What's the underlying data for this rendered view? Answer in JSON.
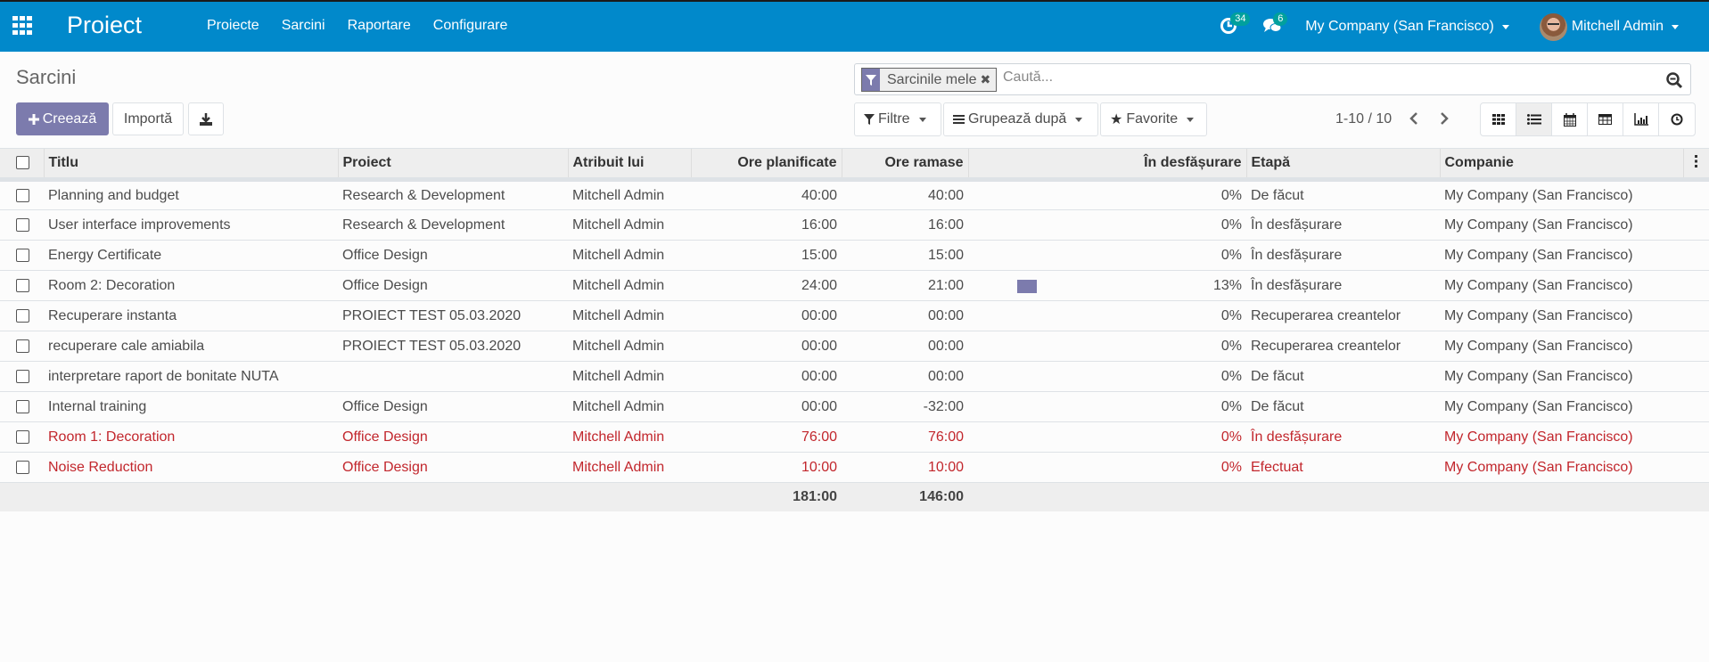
{
  "navbar": {
    "app_name": "Proiect",
    "menu": [
      "Proiecte",
      "Sarcini",
      "Raportare",
      "Configurare"
    ],
    "activity_badge": "34",
    "messages_badge": "6",
    "company": "My Company (San Francisco)",
    "user": "Mitchell Admin"
  },
  "control_panel": {
    "title": "Sarcini",
    "create_label": "Creează",
    "import_label": "Importă",
    "search": {
      "facet_label": "Sarcinile mele",
      "placeholder": "Caută..."
    },
    "filters_label": "Filtre",
    "groupby_label": "Grupează după",
    "favorites_label": "Favorite",
    "pager": "1-10 / 10",
    "views": [
      "kanban",
      "list",
      "calendar",
      "pivot",
      "graph",
      "activity"
    ],
    "active_view": "list"
  },
  "colors": {
    "navbar": "#0189cb",
    "primary": "#7c7bad",
    "late_text": "#c2262c"
  },
  "table": {
    "columns": [
      "Titlu",
      "Proiect",
      "Atribuit lui",
      "Ore planificate",
      "Ore ramase",
      "În desfășurare",
      "Etapă",
      "Companie"
    ],
    "rows": [
      {
        "title": "Planning and budget",
        "project": "Research & Development",
        "assignee": "Mitchell Admin",
        "planned": "40:00",
        "remaining": "40:00",
        "progress": 0,
        "progress_label": "0%",
        "stage": "De făcut",
        "company": "My Company (San Francisco)",
        "late": false
      },
      {
        "title": "User interface improvements",
        "project": "Research & Development",
        "assignee": "Mitchell Admin",
        "planned": "16:00",
        "remaining": "16:00",
        "progress": 0,
        "progress_label": "0%",
        "stage": "În desfășurare",
        "company": "My Company (San Francisco)",
        "late": false
      },
      {
        "title": "Energy Certificate",
        "project": "Office Design",
        "assignee": "Mitchell Admin",
        "planned": "15:00",
        "remaining": "15:00",
        "progress": 0,
        "progress_label": "0%",
        "stage": "În desfășurare",
        "company": "My Company (San Francisco)",
        "late": false
      },
      {
        "title": "Room 2: Decoration",
        "project": "Office Design",
        "assignee": "Mitchell Admin",
        "planned": "24:00",
        "remaining": "21:00",
        "progress": 13,
        "progress_label": "13%",
        "stage": "În desfășurare",
        "company": "My Company (San Francisco)",
        "late": false
      },
      {
        "title": "Recuperare instanta",
        "project": "PROIECT TEST 05.03.2020",
        "assignee": "Mitchell Admin",
        "planned": "00:00",
        "remaining": "00:00",
        "progress": 0,
        "progress_label": "0%",
        "stage": "Recuperarea creantelor",
        "company": "My Company (San Francisco)",
        "late": false
      },
      {
        "title": "recuperare cale amiabila",
        "project": "PROIECT TEST 05.03.2020",
        "assignee": "Mitchell Admin",
        "planned": "00:00",
        "remaining": "00:00",
        "progress": 0,
        "progress_label": "0%",
        "stage": "Recuperarea creantelor",
        "company": "My Company (San Francisco)",
        "late": false
      },
      {
        "title": "interpretare raport de bonitate NUTA",
        "project": "",
        "assignee": "Mitchell Admin",
        "planned": "00:00",
        "remaining": "00:00",
        "progress": 0,
        "progress_label": "0%",
        "stage": "De făcut",
        "company": "My Company (San Francisco)",
        "late": false
      },
      {
        "title": "Internal training",
        "project": "Office Design",
        "assignee": "Mitchell Admin",
        "planned": "00:00",
        "remaining": "-32:00",
        "progress": 0,
        "progress_label": "0%",
        "stage": "De făcut",
        "company": "My Company (San Francisco)",
        "late": false
      },
      {
        "title": "Room 1: Decoration",
        "project": "Office Design",
        "assignee": "Mitchell Admin",
        "planned": "76:00",
        "remaining": "76:00",
        "progress": 0,
        "progress_label": "0%",
        "stage": "În desfășurare",
        "company": "My Company (San Francisco)",
        "late": true
      },
      {
        "title": "Noise Reduction",
        "project": "Office Design",
        "assignee": "Mitchell Admin",
        "planned": "10:00",
        "remaining": "10:00",
        "progress": 0,
        "progress_label": "0%",
        "stage": "Efectuat",
        "company": "My Company (San Francisco)",
        "late": true
      }
    ],
    "totals": {
      "planned": "181:00",
      "remaining": "146:00"
    }
  }
}
